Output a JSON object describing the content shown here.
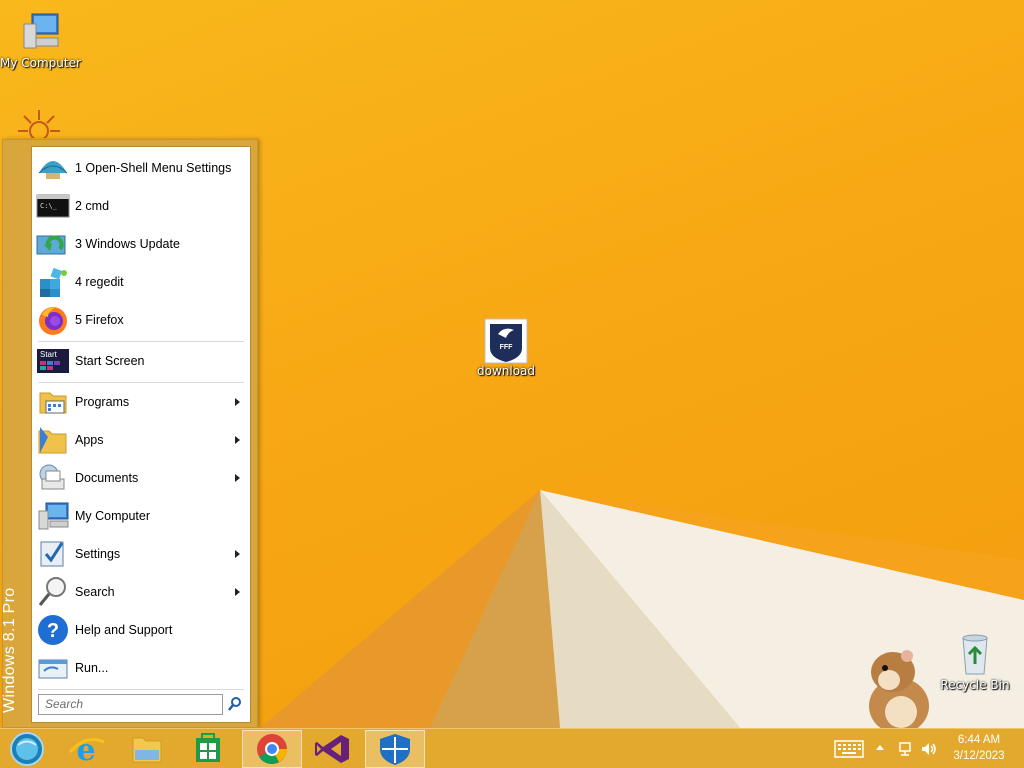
{
  "desktop": {
    "icons": [
      {
        "label": "My Computer"
      },
      {
        "label": "download"
      },
      {
        "label": "Recycle Bin"
      }
    ]
  },
  "start_menu": {
    "brand": "Windows 8.1 Pro",
    "items": [
      {
        "label": "1 Open-Shell Menu Settings",
        "icon": "shell-icon"
      },
      {
        "label": "2 cmd",
        "icon": "cmd-icon"
      },
      {
        "label": "3 Windows Update",
        "icon": "windows-update-icon"
      },
      {
        "label": "4 regedit",
        "icon": "regedit-icon"
      },
      {
        "label": "5 Firefox",
        "icon": "firefox-icon"
      },
      {
        "label": "Start Screen",
        "icon": "start-screen-icon"
      },
      {
        "label": "Programs",
        "icon": "programs-icon"
      },
      {
        "label": "Apps",
        "icon": "apps-icon"
      },
      {
        "label": "Documents",
        "icon": "documents-icon"
      },
      {
        "label": "My Computer",
        "icon": "computer-icon"
      },
      {
        "label": "Settings",
        "icon": "settings-icon"
      },
      {
        "label": "Search",
        "icon": "magnifier-icon"
      },
      {
        "label": "Help and Support",
        "icon": "help-icon"
      },
      {
        "label": "Run...",
        "icon": "run-icon"
      }
    ],
    "search_placeholder": "Search"
  },
  "taskbar": {
    "apps": [
      "start-orb-icon",
      "internet-explorer-icon",
      "file-explorer-icon",
      "store-icon",
      "chrome-icon",
      "visual-studio-icon",
      "defender-icon"
    ],
    "clock_time": "6:44 AM",
    "clock_date": "3/12/2023"
  },
  "colors": {
    "wallpaper": "#f7a814",
    "menu_frame": "#d9a63c",
    "taskbar": "#e3a92f"
  }
}
